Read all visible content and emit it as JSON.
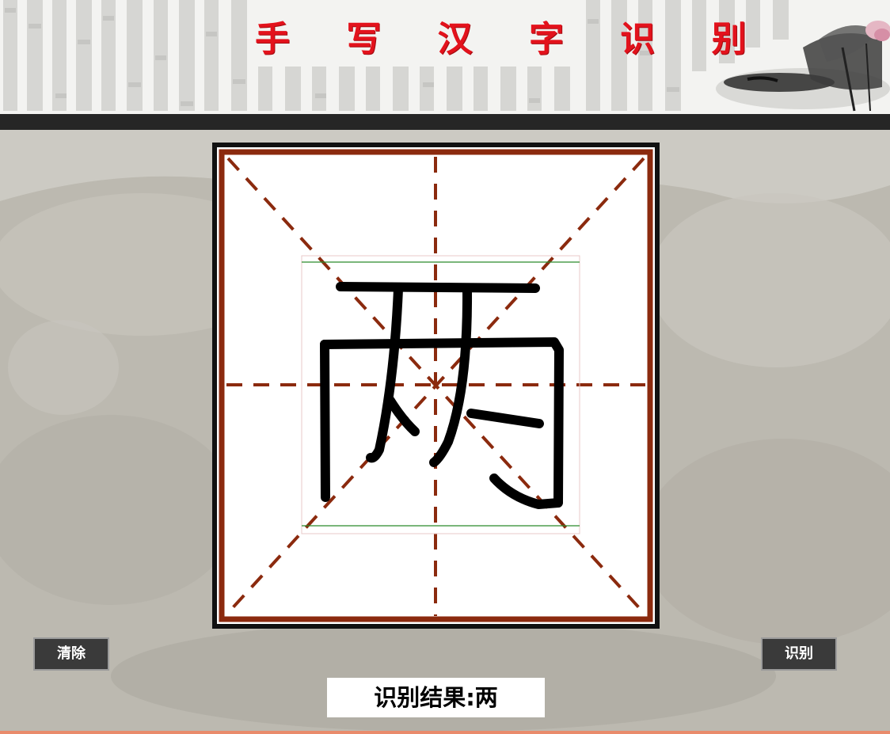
{
  "header": {
    "title": "手 写 汉 字 识 别"
  },
  "toolbar": {
    "clear_label": "清除",
    "recognize_label": "识别"
  },
  "result": {
    "label": "识别结果:",
    "value": "两"
  },
  "colors": {
    "title": "#e3121c",
    "grid_border": "#8b2a0e",
    "button_bg": "#3a3a3a",
    "header_bar": "#262626",
    "bottom_line": "#e98b6c"
  }
}
